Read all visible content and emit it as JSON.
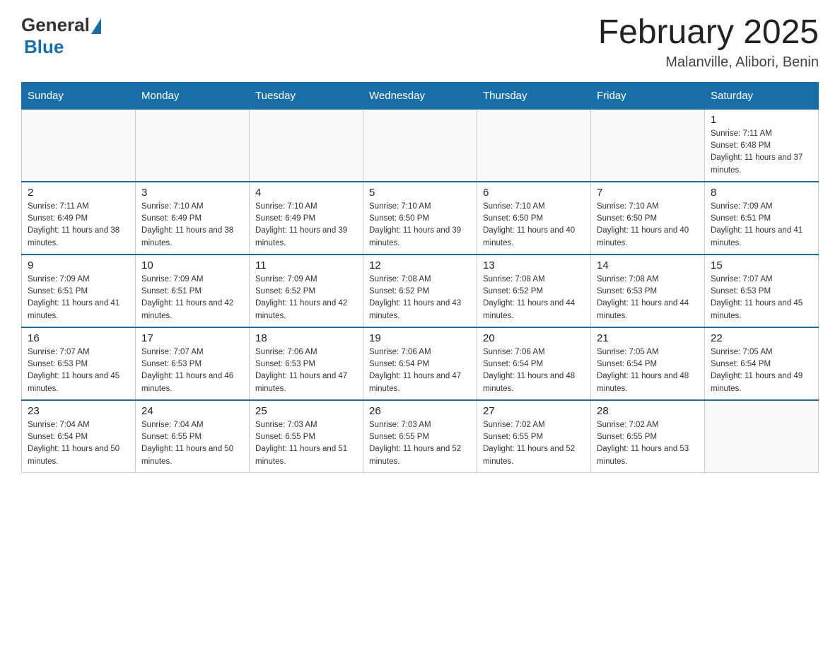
{
  "header": {
    "logo": {
      "text_general": "General",
      "text_blue": "Blue"
    },
    "title": "February 2025",
    "location": "Malanville, Alibori, Benin"
  },
  "days_of_week": [
    "Sunday",
    "Monday",
    "Tuesday",
    "Wednesday",
    "Thursday",
    "Friday",
    "Saturday"
  ],
  "weeks": [
    {
      "days": [
        {
          "num": "",
          "info": ""
        },
        {
          "num": "",
          "info": ""
        },
        {
          "num": "",
          "info": ""
        },
        {
          "num": "",
          "info": ""
        },
        {
          "num": "",
          "info": ""
        },
        {
          "num": "",
          "info": ""
        },
        {
          "num": "1",
          "info": "Sunrise: 7:11 AM\nSunset: 6:48 PM\nDaylight: 11 hours and 37 minutes."
        }
      ]
    },
    {
      "days": [
        {
          "num": "2",
          "info": "Sunrise: 7:11 AM\nSunset: 6:49 PM\nDaylight: 11 hours and 38 minutes."
        },
        {
          "num": "3",
          "info": "Sunrise: 7:10 AM\nSunset: 6:49 PM\nDaylight: 11 hours and 38 minutes."
        },
        {
          "num": "4",
          "info": "Sunrise: 7:10 AM\nSunset: 6:49 PM\nDaylight: 11 hours and 39 minutes."
        },
        {
          "num": "5",
          "info": "Sunrise: 7:10 AM\nSunset: 6:50 PM\nDaylight: 11 hours and 39 minutes."
        },
        {
          "num": "6",
          "info": "Sunrise: 7:10 AM\nSunset: 6:50 PM\nDaylight: 11 hours and 40 minutes."
        },
        {
          "num": "7",
          "info": "Sunrise: 7:10 AM\nSunset: 6:50 PM\nDaylight: 11 hours and 40 minutes."
        },
        {
          "num": "8",
          "info": "Sunrise: 7:09 AM\nSunset: 6:51 PM\nDaylight: 11 hours and 41 minutes."
        }
      ]
    },
    {
      "days": [
        {
          "num": "9",
          "info": "Sunrise: 7:09 AM\nSunset: 6:51 PM\nDaylight: 11 hours and 41 minutes."
        },
        {
          "num": "10",
          "info": "Sunrise: 7:09 AM\nSunset: 6:51 PM\nDaylight: 11 hours and 42 minutes."
        },
        {
          "num": "11",
          "info": "Sunrise: 7:09 AM\nSunset: 6:52 PM\nDaylight: 11 hours and 42 minutes."
        },
        {
          "num": "12",
          "info": "Sunrise: 7:08 AM\nSunset: 6:52 PM\nDaylight: 11 hours and 43 minutes."
        },
        {
          "num": "13",
          "info": "Sunrise: 7:08 AM\nSunset: 6:52 PM\nDaylight: 11 hours and 44 minutes."
        },
        {
          "num": "14",
          "info": "Sunrise: 7:08 AM\nSunset: 6:53 PM\nDaylight: 11 hours and 44 minutes."
        },
        {
          "num": "15",
          "info": "Sunrise: 7:07 AM\nSunset: 6:53 PM\nDaylight: 11 hours and 45 minutes."
        }
      ]
    },
    {
      "days": [
        {
          "num": "16",
          "info": "Sunrise: 7:07 AM\nSunset: 6:53 PM\nDaylight: 11 hours and 45 minutes."
        },
        {
          "num": "17",
          "info": "Sunrise: 7:07 AM\nSunset: 6:53 PM\nDaylight: 11 hours and 46 minutes."
        },
        {
          "num": "18",
          "info": "Sunrise: 7:06 AM\nSunset: 6:53 PM\nDaylight: 11 hours and 47 minutes."
        },
        {
          "num": "19",
          "info": "Sunrise: 7:06 AM\nSunset: 6:54 PM\nDaylight: 11 hours and 47 minutes."
        },
        {
          "num": "20",
          "info": "Sunrise: 7:06 AM\nSunset: 6:54 PM\nDaylight: 11 hours and 48 minutes."
        },
        {
          "num": "21",
          "info": "Sunrise: 7:05 AM\nSunset: 6:54 PM\nDaylight: 11 hours and 48 minutes."
        },
        {
          "num": "22",
          "info": "Sunrise: 7:05 AM\nSunset: 6:54 PM\nDaylight: 11 hours and 49 minutes."
        }
      ]
    },
    {
      "days": [
        {
          "num": "23",
          "info": "Sunrise: 7:04 AM\nSunset: 6:54 PM\nDaylight: 11 hours and 50 minutes."
        },
        {
          "num": "24",
          "info": "Sunrise: 7:04 AM\nSunset: 6:55 PM\nDaylight: 11 hours and 50 minutes."
        },
        {
          "num": "25",
          "info": "Sunrise: 7:03 AM\nSunset: 6:55 PM\nDaylight: 11 hours and 51 minutes."
        },
        {
          "num": "26",
          "info": "Sunrise: 7:03 AM\nSunset: 6:55 PM\nDaylight: 11 hours and 52 minutes."
        },
        {
          "num": "27",
          "info": "Sunrise: 7:02 AM\nSunset: 6:55 PM\nDaylight: 11 hours and 52 minutes."
        },
        {
          "num": "28",
          "info": "Sunrise: 7:02 AM\nSunset: 6:55 PM\nDaylight: 11 hours and 53 minutes."
        },
        {
          "num": "",
          "info": ""
        }
      ]
    }
  ]
}
